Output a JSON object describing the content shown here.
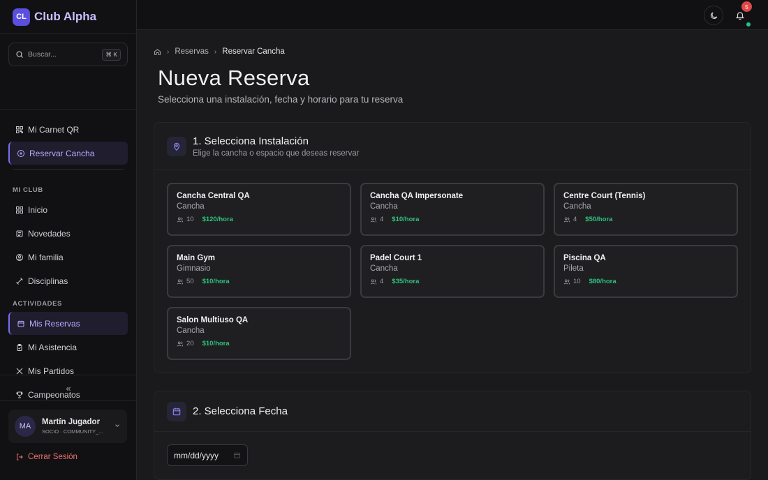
{
  "brand": {
    "logo": "CL",
    "name": "Club Alpha"
  },
  "search": {
    "placeholder": "Buscar...",
    "shortcut": "⌘ K"
  },
  "nav_top": [
    {
      "label": "Mi Carnet QR",
      "icon": "qr-icon"
    },
    {
      "label": "Reservar Cancha",
      "icon": "plus-circle-icon",
      "active": true
    }
  ],
  "sections": {
    "mi_club": {
      "title": "MI CLUB",
      "items": [
        {
          "label": "Inicio",
          "icon": "grid-icon"
        },
        {
          "label": "Novedades",
          "icon": "newspaper-icon"
        },
        {
          "label": "Mi familia",
          "icon": "user-circle-icon"
        },
        {
          "label": "Disciplinas",
          "icon": "dumbbell-icon"
        }
      ]
    },
    "actividades": {
      "title": "ACTIVIDADES",
      "items": [
        {
          "label": "Mis Reservas",
          "icon": "calendar-icon",
          "active": true
        },
        {
          "label": "Mi Asistencia",
          "icon": "clipboard-icon"
        },
        {
          "label": "Mis Partidos",
          "icon": "swords-icon"
        },
        {
          "label": "Campeonatos",
          "icon": "trophy-icon"
        }
      ]
    }
  },
  "collapse_label": "«",
  "user": {
    "initials": "MA",
    "name": "Martín Jugador",
    "role": "SOCIO · COMMUNITY_..."
  },
  "logout_label": "Cerrar Sesión",
  "topbar": {
    "notifications": "5"
  },
  "breadcrumb": {
    "parent": "Reservas",
    "current": "Reservar Cancha"
  },
  "page": {
    "title": "Nueva Reserva",
    "subtitle": "Selecciona una instalación, fecha y horario para tu reserva"
  },
  "step1": {
    "title": "1. Selecciona Instalación",
    "subtitle": "Elige la cancha o espacio que deseas reservar"
  },
  "facilities": [
    {
      "name": "Cancha Central QA",
      "type": "Cancha",
      "capacity": "10",
      "price": "$120/hora"
    },
    {
      "name": "Cancha QA Impersonate",
      "type": "Cancha",
      "capacity": "4",
      "price": "$10/hora"
    },
    {
      "name": "Centre Court (Tennis)",
      "type": "Cancha",
      "capacity": "4",
      "price": "$50/hora"
    },
    {
      "name": "Main Gym",
      "type": "Gimnasio",
      "capacity": "50",
      "price": "$10/hora"
    },
    {
      "name": "Padel Court 1",
      "type": "Cancha",
      "capacity": "4",
      "price": "$35/hora"
    },
    {
      "name": "Piscina QA",
      "type": "Pileta",
      "capacity": "10",
      "price": "$80/hora"
    },
    {
      "name": "Salon Multiuso QA",
      "type": "Cancha",
      "capacity": "20",
      "price": "$10/hora"
    }
  ],
  "step2": {
    "title": "2. Selecciona Fecha",
    "date_placeholder": "mm/dd/yyyy"
  },
  "colors": {
    "accent": "#7a6ff0",
    "price": "#2fc27c",
    "danger": "#f07070",
    "badge": "#e04848"
  }
}
